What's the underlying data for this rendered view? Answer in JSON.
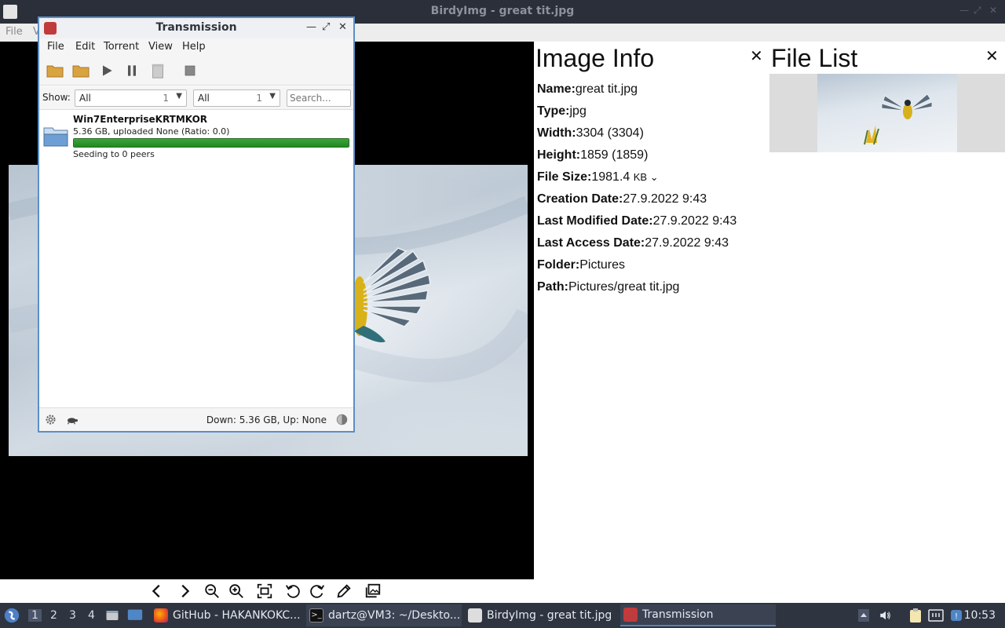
{
  "birdy": {
    "window_title": "BirdyImg - great tit.jpg",
    "menu": [
      "File",
      "V"
    ]
  },
  "image_info": {
    "title": "Image Info",
    "rows": [
      {
        "label": "Name",
        "value": "great tit.jpg"
      },
      {
        "label": "Type",
        "value": "jpg"
      },
      {
        "label": "Width",
        "value": "3304 (3304)"
      },
      {
        "label": "Height",
        "value": "1859 (1859)"
      },
      {
        "label": "File Size",
        "value": "1981.4",
        "unit": "KB"
      },
      {
        "label": "Creation Date",
        "value": "27.9.2022 9:43"
      },
      {
        "label": "Last Modified Date",
        "value": "27.9.2022 9:43"
      },
      {
        "label": "Last Access Date",
        "value": "27.9.2022 9:43"
      },
      {
        "label": "Folder",
        "value": "Pictures"
      },
      {
        "label": "Path",
        "value": "Pictures/great tit.jpg"
      }
    ]
  },
  "file_list": {
    "title": "File List"
  },
  "transmission": {
    "window_title": "Transmission",
    "menu": [
      "File",
      "Edit",
      "Torrent",
      "View",
      "Help"
    ],
    "filter": {
      "show_label": "Show:",
      "category": {
        "value": "All",
        "count": "1"
      },
      "tracker": {
        "value": "All",
        "count": "1"
      },
      "search_placeholder": "Search..."
    },
    "torrent": {
      "name": "Win7EnterpriseKRTMKOR",
      "progress_text": "5.36 GB, uploaded None (Ratio: 0.0)",
      "progress": 1.0,
      "status": "Seeding to 0 peers"
    },
    "statusbar": {
      "speed": "Down: 5.36 GB, Up: None"
    }
  },
  "taskbar": {
    "workspaces": [
      "1",
      "2",
      "3",
      "4"
    ],
    "tasks": [
      {
        "label": "GitHub - HAKANKOKC..."
      },
      {
        "label": "dartz@VM3: ~/Deskto..."
      },
      {
        "label": "BirdyImg - great tit.jpg"
      },
      {
        "label": "Transmission"
      }
    ],
    "clock": "10:53"
  },
  "colors": {
    "progress_green": "#2a9a2a",
    "transmission_border": "#5b8fc7",
    "taskbar_bg": "#2e3440"
  }
}
